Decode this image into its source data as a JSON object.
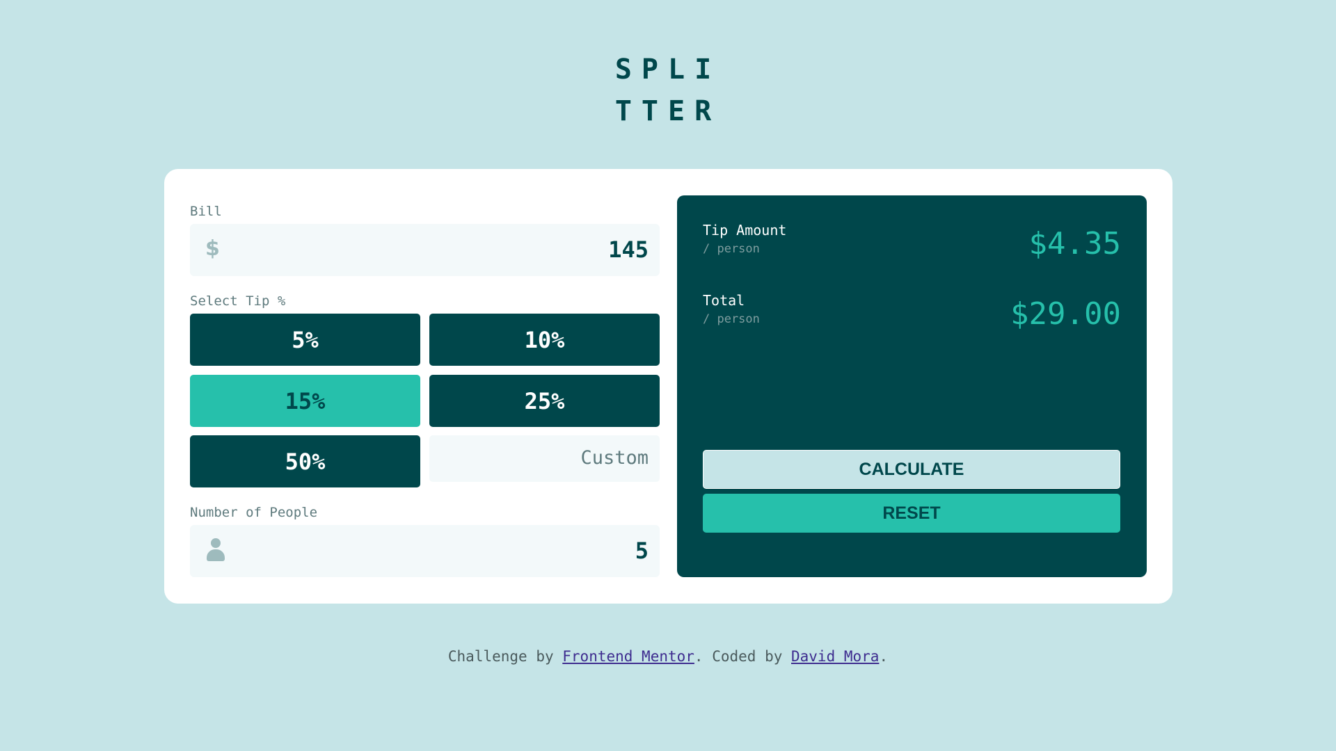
{
  "logo": {
    "line1": "SPLI",
    "line2": "TTER"
  },
  "bill": {
    "label": "Bill",
    "currency_symbol": "$",
    "value": "145"
  },
  "tip": {
    "label": "Select Tip %",
    "options": [
      "5%",
      "10%",
      "15%",
      "25%",
      "50%"
    ],
    "selected": "15%",
    "custom_placeholder": "Custom"
  },
  "people": {
    "label": "Number of People",
    "value": "5",
    "icon": "person-icon"
  },
  "results": {
    "tip_label": "Tip Amount",
    "tip_sub": "/ person",
    "tip_value": "$4.35",
    "total_label": "Total",
    "total_sub": "/ person",
    "total_value": "$29.00"
  },
  "actions": {
    "calculate": "CALCULATE",
    "reset": "RESET"
  },
  "footer": {
    "prefix": "Challenge by ",
    "link1": "Frontend Mentor",
    "middle": ". Coded by ",
    "link2": "David Mora",
    "suffix": "."
  },
  "colors": {
    "background": "#c5e4e7",
    "dark_cyan": "#00474b",
    "accent": "#26c0ab",
    "input_bg": "#f3f9fa"
  }
}
